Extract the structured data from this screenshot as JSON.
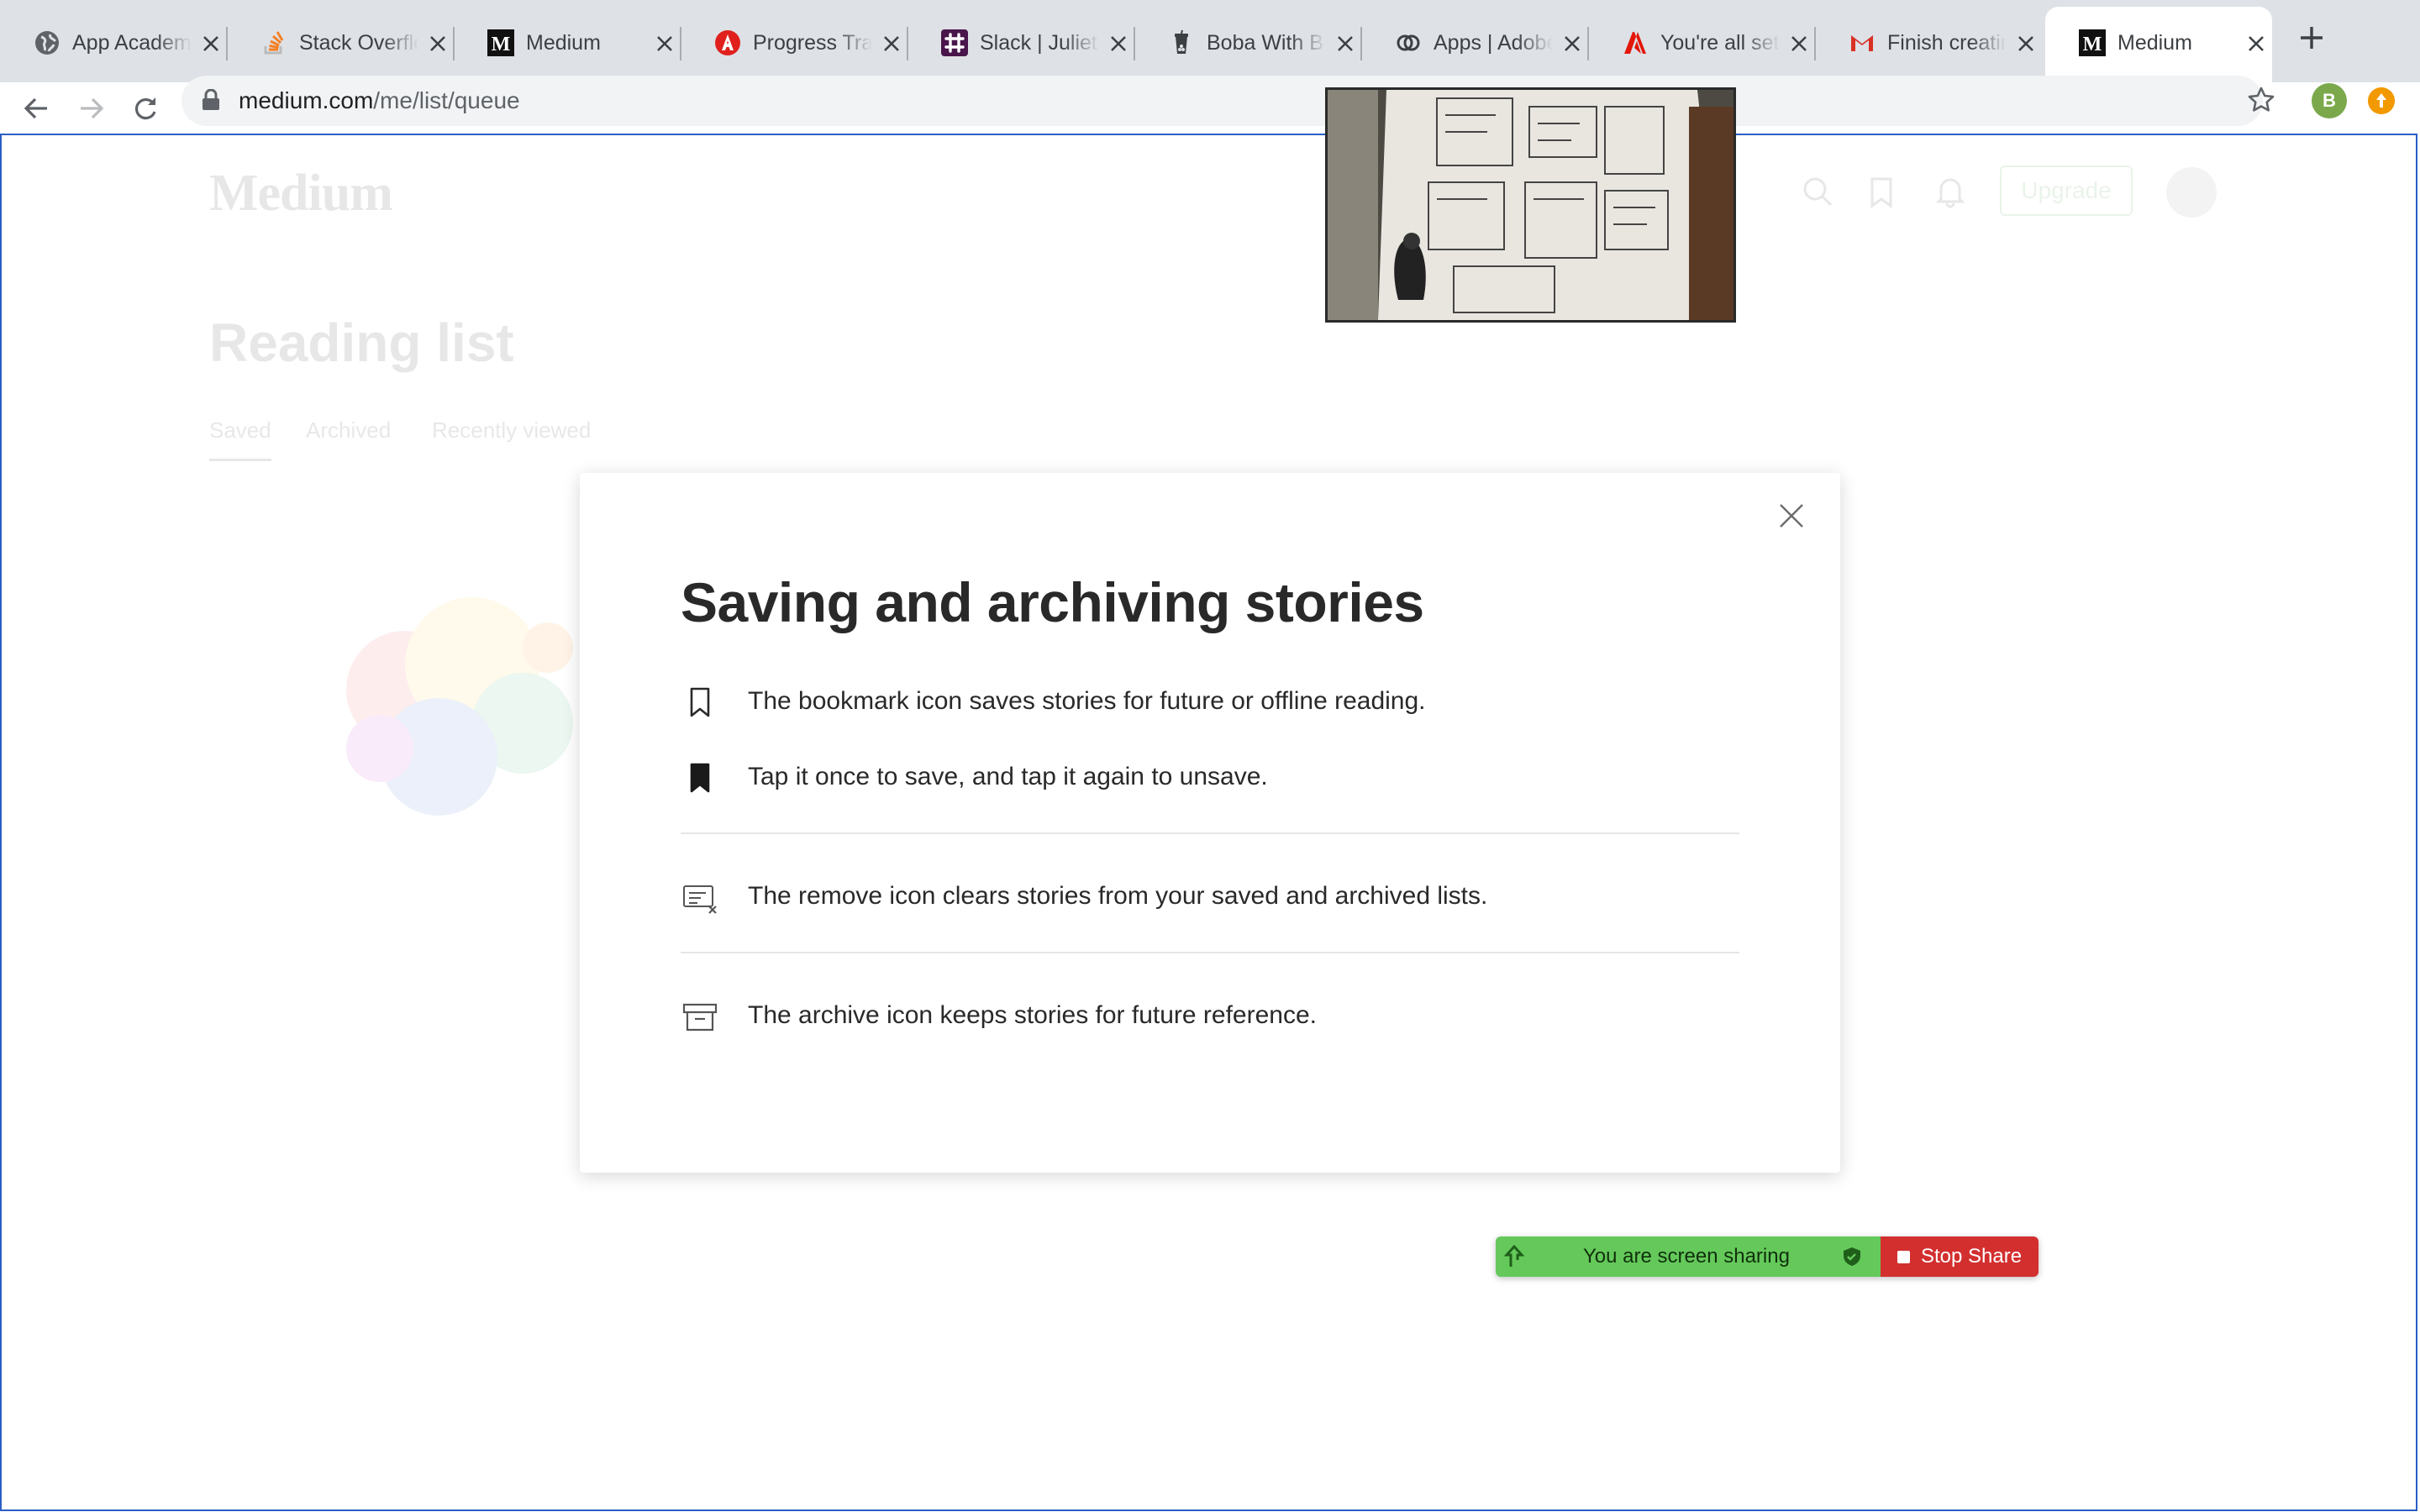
{
  "browser": {
    "tabs": [
      {
        "title": "App Academy",
        "icon": "globe-icon",
        "active": false
      },
      {
        "title": "Stack Overflow",
        "icon": "stackoverflow-icon",
        "active": false
      },
      {
        "title": "Medium",
        "icon": "medium-icon",
        "active": false
      },
      {
        "title": "Progress Tracker",
        "icon": "progress-tracker-icon",
        "active": false
      },
      {
        "title": "Slack | Juliet",
        "icon": "slack-icon",
        "active": false
      },
      {
        "title": "Boba With B",
        "icon": "boba-icon",
        "active": false
      },
      {
        "title": "Apps | Adobe",
        "icon": "adobe-cc-icon",
        "active": false
      },
      {
        "title": "You're all set",
        "icon": "adobe-icon",
        "active": false
      },
      {
        "title": "Finish creating",
        "icon": "gmail-icon",
        "active": false
      },
      {
        "title": "Medium",
        "icon": "medium-icon",
        "active": true
      }
    ],
    "url_host": "medium.com",
    "url_path": "/me/list/queue",
    "profile_initial": "B"
  },
  "page": {
    "logo": "Medium",
    "heading": "Reading list",
    "tabs": [
      "Saved",
      "Archived",
      "Recently viewed"
    ],
    "upgrade_label": "Upgrade"
  },
  "modal": {
    "title": "Saving and archiving stories",
    "rows": [
      {
        "icon": "bookmark-outline-icon",
        "text": "The bookmark icon saves stories for future or offline reading."
      },
      {
        "icon": "bookmark-filled-icon",
        "text": "Tap it once to save, and tap it again to unsave."
      },
      {
        "icon": "remove-icon",
        "text": "The remove icon clears stories from your saved and archived lists."
      },
      {
        "icon": "archive-icon",
        "text": "The archive icon keeps stories for future reference."
      }
    ]
  },
  "share_bar": {
    "status": "You are screen sharing",
    "stop_label": "Stop Share",
    "colors": {
      "status_bg": "#64c95a",
      "stop_bg": "#d32f2f"
    }
  }
}
